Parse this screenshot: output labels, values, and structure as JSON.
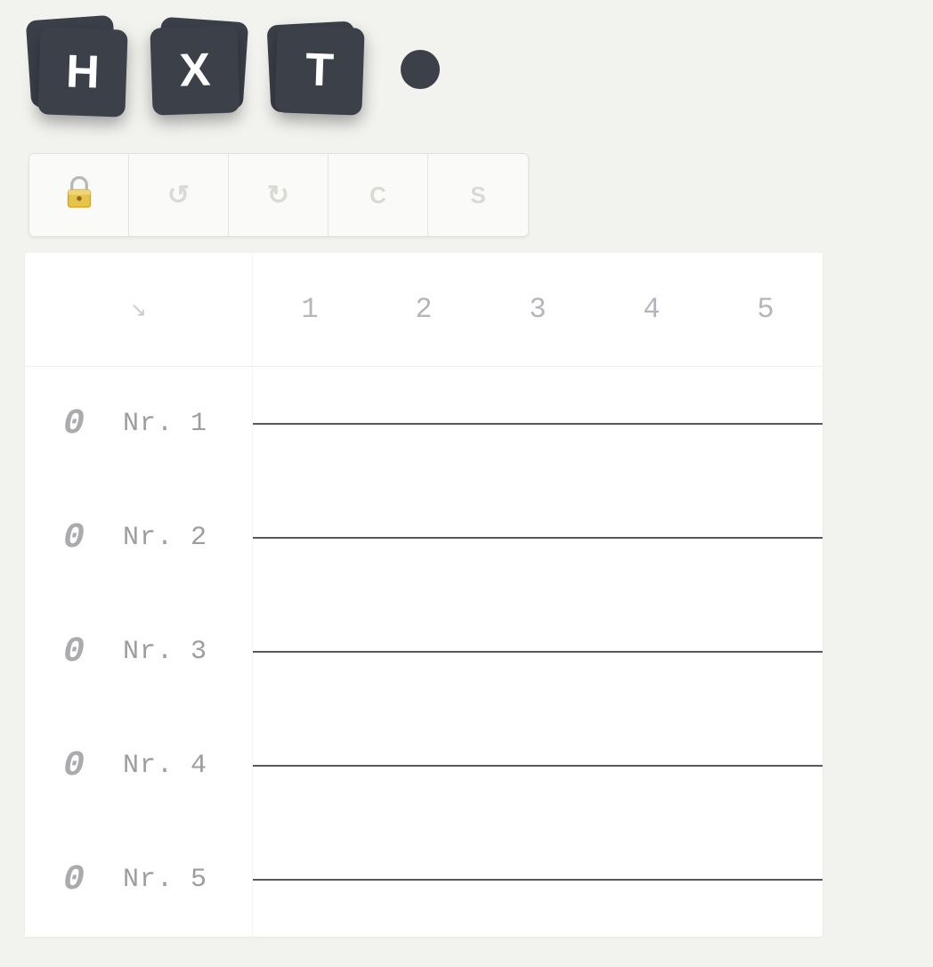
{
  "logo": {
    "letters": [
      "H",
      "X",
      "T"
    ]
  },
  "toolbar": {
    "lock_label": "",
    "undo_label": "↺",
    "redo_label": "↻",
    "c_label": "C",
    "s_label": "S"
  },
  "grid": {
    "corner_icon": "↘",
    "columns": [
      "1",
      "2",
      "3",
      "4",
      "5"
    ],
    "rows": [
      {
        "score": "0",
        "label": "Nr. 1"
      },
      {
        "score": "0",
        "label": "Nr. 2"
      },
      {
        "score": "0",
        "label": "Nr. 3"
      },
      {
        "score": "0",
        "label": "Nr. 4"
      },
      {
        "score": "0",
        "label": "Nr. 5"
      }
    ]
  }
}
